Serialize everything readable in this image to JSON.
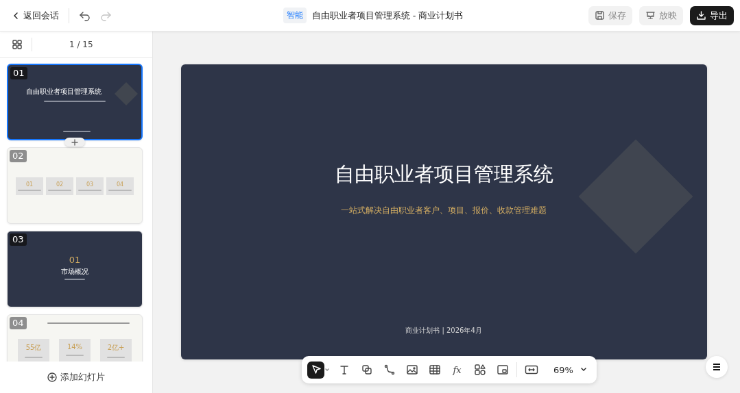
{
  "topbar": {
    "back_label": "返回会话",
    "undo": {
      "disabled": false
    },
    "redo": {
      "disabled": true
    },
    "badge": "智能",
    "title": "自由职业者项目管理系统 - 商业计划书",
    "buttons": [
      {
        "kind": "save",
        "label": "保存"
      },
      {
        "kind": "play",
        "label": "放映"
      },
      {
        "kind": "export",
        "label": "导出"
      }
    ]
  },
  "sidebar": {
    "page_indicator": "1 / 15",
    "slides": [
      {
        "number": "01",
        "kind": "cover",
        "selected": true,
        "title": "自由职业者项目管理系统"
      },
      {
        "number": "02",
        "kind": "agenda",
        "selected": false,
        "items": [
          "01",
          "02",
          "03",
          "04"
        ]
      },
      {
        "number": "03",
        "kind": "section",
        "selected": false,
        "items": [
          "01"
        ],
        "title": "市场概况"
      },
      {
        "number": "04",
        "kind": "stats",
        "selected": false,
        "items": [
          "55亿",
          "14%",
          "2亿+"
        ]
      }
    ],
    "add_slide": "添加幻灯片"
  },
  "slide": {
    "title": "自由职业者项目管理系统",
    "subtitle": "一站式解决自由职业者客户、项目、报价、收款管理难题",
    "footer": "商业计划书 | 2026年4月"
  },
  "toolbar": {
    "tools": [
      {
        "kind": "select",
        "selected": true
      },
      {
        "kind": "text",
        "selected": false
      },
      {
        "kind": "shape",
        "selected": false
      },
      {
        "kind": "connector",
        "selected": false
      },
      {
        "kind": "image",
        "selected": false
      },
      {
        "kind": "table",
        "selected": false
      },
      {
        "kind": "formula",
        "selected": false,
        "glyph": "fx"
      },
      {
        "kind": "components",
        "selected": false
      },
      {
        "kind": "media",
        "selected": false
      }
    ],
    "zoom": "69%"
  }
}
